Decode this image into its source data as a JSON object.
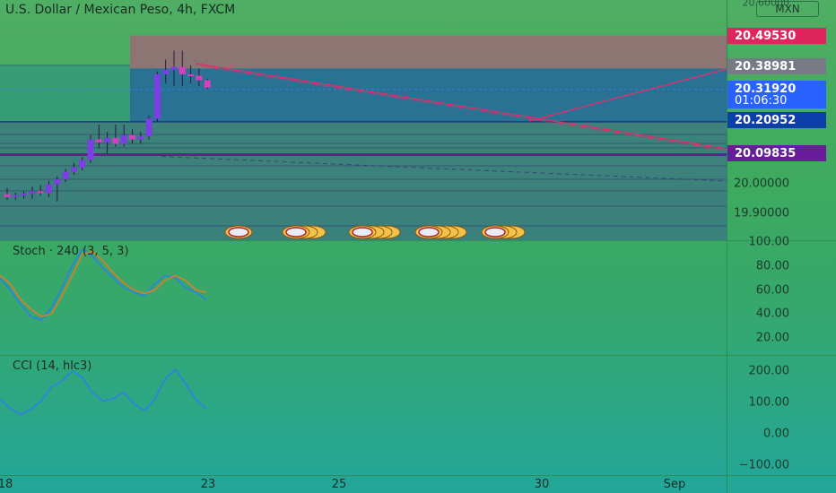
{
  "header": {
    "title": "U.S. Dollar / Mexican Peso, 4h, FXCM",
    "currency_badge": "MXN",
    "top_axis_partial": "20.60000"
  },
  "price_axis": {
    "labels": [
      "20.00000",
      "19.90000"
    ],
    "tags": [
      {
        "text": "20.49530",
        "color": "#e0245e",
        "price": 20.4953
      },
      {
        "text": "20.38981",
        "color": "#787b86",
        "price": 20.38981
      },
      {
        "text": "20.31920",
        "color": "#2962ff",
        "price": 20.3192
      },
      {
        "text": "01:06:30",
        "color": "#2962ff",
        "price": 20.3192
      },
      {
        "text": "20.20952",
        "color": "#0d3fa8",
        "price": 20.20952
      },
      {
        "text": "20.09835",
        "color": "#6a1b9a",
        "price": 20.09835
      }
    ]
  },
  "stoch": {
    "title": "Stoch · 240 (3, 5, 3)",
    "axis_labels": [
      "100.00",
      "80.00",
      "60.00",
      "40.00",
      "20.00"
    ]
  },
  "cci": {
    "title": "CCI (14, hlc3)",
    "axis_labels": [
      "200.00",
      "100.00",
      "0.00",
      "−100.00"
    ]
  },
  "time_axis": {
    "labels": [
      "18",
      "23",
      "25",
      "30",
      "Sep"
    ]
  },
  "colors": {
    "up": "#7b3fe4",
    "down": "#d63fbf",
    "stoch_k": "#2f7fe6",
    "stoch_d": "#e07a2c",
    "cci": "#2f7fe6",
    "trendline": "#d6336c"
  },
  "chart_data": [
    {
      "type": "candlestick",
      "title": "U.S. Dollar / Mexican Peso, 4h, FXCM",
      "ylim": [
        19.85,
        20.6
      ],
      "candles": [
        {
          "o": 19.965,
          "h": 19.985,
          "l": 19.945,
          "c": 19.955
        },
        {
          "o": 19.955,
          "h": 19.97,
          "l": 19.945,
          "c": 19.962
        },
        {
          "o": 19.96,
          "h": 19.975,
          "l": 19.95,
          "c": 19.966
        },
        {
          "o": 19.966,
          "h": 19.99,
          "l": 19.95,
          "c": 19.975
        },
        {
          "o": 19.975,
          "h": 19.995,
          "l": 19.96,
          "c": 19.968
        },
        {
          "o": 19.968,
          "h": 20.01,
          "l": 19.955,
          "c": 19.998
        },
        {
          "o": 19.998,
          "h": 20.025,
          "l": 19.94,
          "c": 20.015
        },
        {
          "o": 20.015,
          "h": 20.05,
          "l": 20.005,
          "c": 20.04
        },
        {
          "o": 20.04,
          "h": 20.07,
          "l": 20.03,
          "c": 20.055
        },
        {
          "o": 20.055,
          "h": 20.09,
          "l": 20.045,
          "c": 20.08
        },
        {
          "o": 20.08,
          "h": 20.165,
          "l": 20.07,
          "c": 20.15
        },
        {
          "o": 20.15,
          "h": 20.2,
          "l": 20.12,
          "c": 20.14
        },
        {
          "o": 20.14,
          "h": 20.175,
          "l": 20.1,
          "c": 20.155
        },
        {
          "o": 20.155,
          "h": 20.2,
          "l": 20.125,
          "c": 20.135
        },
        {
          "o": 20.135,
          "h": 20.2,
          "l": 20.125,
          "c": 20.165
        },
        {
          "o": 20.165,
          "h": 20.185,
          "l": 20.135,
          "c": 20.15
        },
        {
          "o": 20.15,
          "h": 20.175,
          "l": 20.135,
          "c": 20.16
        },
        {
          "o": 20.16,
          "h": 20.23,
          "l": 20.15,
          "c": 20.22
        },
        {
          "o": 20.22,
          "h": 20.38,
          "l": 20.21,
          "c": 20.37
        },
        {
          "o": 20.37,
          "h": 20.42,
          "l": 20.34,
          "c": 20.385
        },
        {
          "o": 20.385,
          "h": 20.45,
          "l": 20.33,
          "c": 20.395
        },
        {
          "o": 20.395,
          "h": 20.45,
          "l": 20.33,
          "c": 20.37
        },
        {
          "o": 20.37,
          "h": 20.4,
          "l": 20.34,
          "c": 20.365
        },
        {
          "o": 20.365,
          "h": 20.39,
          "l": 20.33,
          "c": 20.35
        },
        {
          "o": 20.35,
          "h": 20.355,
          "l": 20.32,
          "c": 20.325
        }
      ],
      "levels": {
        "stop": 20.4953,
        "entry": 20.38981,
        "last": 20.3192,
        "target": 20.20952,
        "support": 20.09835
      }
    },
    {
      "type": "line",
      "title": "Stoch · 240 (3, 5, 3)",
      "ylim": [
        10,
        100
      ],
      "series": [
        {
          "name": "",
          "values": [
            70,
            60,
            48,
            38,
            35,
            45,
            62,
            80,
            94,
            88,
            78,
            70,
            62,
            58,
            55,
            65,
            72,
            70,
            62,
            58,
            52
          ]
        },
        {
          "name": "",
          "values": [
            72,
            65,
            52,
            44,
            38,
            40,
            55,
            72,
            90,
            92,
            84,
            74,
            66,
            60,
            57,
            60,
            68,
            72,
            68,
            60,
            58
          ]
        }
      ]
    },
    {
      "type": "line",
      "title": "CCI (14, hlc3)",
      "ylim": [
        -120,
        240
      ],
      "series": [
        {
          "name": "",
          "values": [
            110,
            80,
            62,
            78,
            105,
            150,
            168,
            200,
            180,
            130,
            105,
            112,
            132,
            95,
            75,
            110,
            175,
            205,
            160,
            110,
            80
          ]
        }
      ]
    }
  ]
}
